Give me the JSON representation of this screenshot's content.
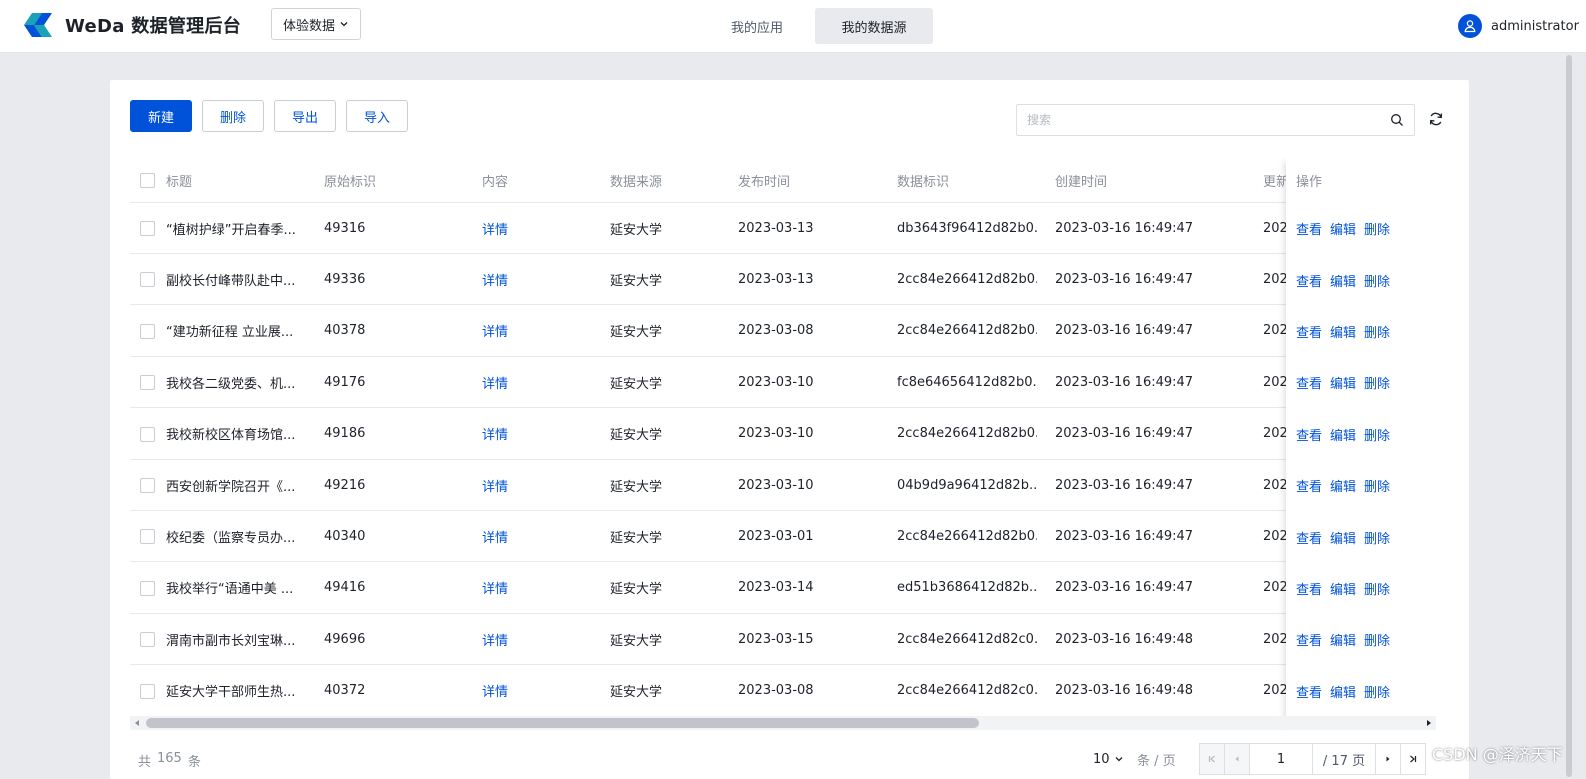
{
  "header": {
    "brand": "WeDa 数据管理后台",
    "env_select": "体验数据",
    "nav_tabs": [
      {
        "label": "我的应用",
        "active": false
      },
      {
        "label": "我的数据源",
        "active": true
      }
    ],
    "user": "administrator",
    "accent": "#0052d9"
  },
  "toolbar": {
    "new_label": "新建",
    "delete_label": "删除",
    "export_label": "导出",
    "import_label": "导入",
    "search_placeholder": "搜索"
  },
  "table": {
    "columns": {
      "title": "标题",
      "original_id": "原始标识",
      "content": "内容",
      "source": "数据来源",
      "publish_time": "发布时间",
      "data_id": "数据标识",
      "created_time": "创建时间",
      "updated_time": "更新",
      "actions": "操作"
    },
    "row_actions": {
      "view": "查看",
      "edit": "编辑",
      "delete": "删除"
    },
    "rows": [
      {
        "title": "“植树护绿”开启春季...",
        "original_id": "49316",
        "content": "详情",
        "source": "延安大学",
        "publish_time": "2023-03-13",
        "data_id": "db3643f96412d82b0...",
        "created_time": "2023-03-16 16:49:47",
        "updated_time": "202..."
      },
      {
        "title": "副校长付峰带队赴中...",
        "original_id": "49336",
        "content": "详情",
        "source": "延安大学",
        "publish_time": "2023-03-13",
        "data_id": "2cc84e266412d82b0...",
        "created_time": "2023-03-16 16:49:47",
        "updated_time": "202..."
      },
      {
        "title": "“建功新征程 立业展...",
        "original_id": "40378",
        "content": "详情",
        "source": "延安大学",
        "publish_time": "2023-03-08",
        "data_id": "2cc84e266412d82b0...",
        "created_time": "2023-03-16 16:49:47",
        "updated_time": "202..."
      },
      {
        "title": "我校各二级党委、机...",
        "original_id": "49176",
        "content": "详情",
        "source": "延安大学",
        "publish_time": "2023-03-10",
        "data_id": "fc8e64656412d82b0...",
        "created_time": "2023-03-16 16:49:47",
        "updated_time": "202..."
      },
      {
        "title": "我校新校区体育场馆...",
        "original_id": "49186",
        "content": "详情",
        "source": "延安大学",
        "publish_time": "2023-03-10",
        "data_id": "2cc84e266412d82b0...",
        "created_time": "2023-03-16 16:49:47",
        "updated_time": "202..."
      },
      {
        "title": "西安创新学院召开《...",
        "original_id": "49216",
        "content": "详情",
        "source": "延安大学",
        "publish_time": "2023-03-10",
        "data_id": "04b9d9a96412d82b...",
        "created_time": "2023-03-16 16:49:47",
        "updated_time": "202..."
      },
      {
        "title": "校纪委（监察专员办...",
        "original_id": "40340",
        "content": "详情",
        "source": "延安大学",
        "publish_time": "2023-03-01",
        "data_id": "2cc84e266412d82b0...",
        "created_time": "2023-03-16 16:49:47",
        "updated_time": "202..."
      },
      {
        "title": "我校举行“语通中美 ...",
        "original_id": "49416",
        "content": "详情",
        "source": "延安大学",
        "publish_time": "2023-03-14",
        "data_id": "ed51b3686412d82b...",
        "created_time": "2023-03-16 16:49:47",
        "updated_time": "202..."
      },
      {
        "title": "渭南市副市长刘宝琳...",
        "original_id": "49696",
        "content": "详情",
        "source": "延安大学",
        "publish_time": "2023-03-15",
        "data_id": "2cc84e266412d82c0...",
        "created_time": "2023-03-16 16:49:48",
        "updated_time": "202..."
      },
      {
        "title": "延安大学干部师生热...",
        "original_id": "40372",
        "content": "详情",
        "source": "延安大学",
        "publish_time": "2023-03-08",
        "data_id": "2cc84e266412d82c0...",
        "created_time": "2023-03-16 16:49:48",
        "updated_time": "202..."
      }
    ]
  },
  "pagination": {
    "total_prefix": "共",
    "total": "165",
    "total_suffix": "条",
    "page_size": "10",
    "page_size_unit": "条 / 页",
    "current_page": "1",
    "page_count": "/ 17 页"
  },
  "watermark": "CSDN @泽济天下"
}
